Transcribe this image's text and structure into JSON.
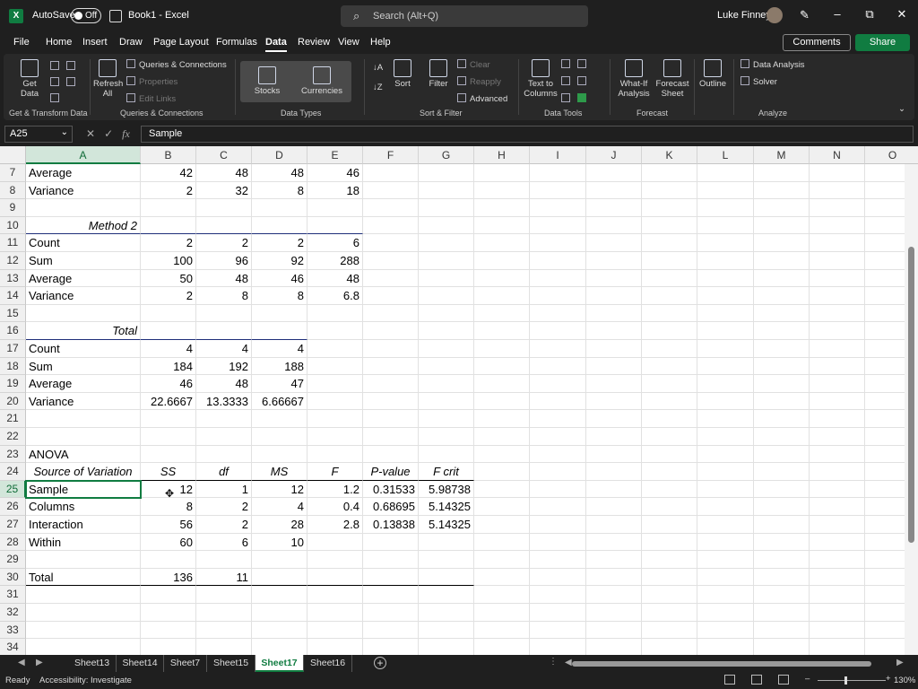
{
  "title_bar": {
    "logo": "X",
    "autosave_label": "AutoSave",
    "autosave_state": "Off",
    "document_title": "Book1  -  Excel",
    "search_placeholder": "Search (Alt+Q)",
    "user_name": "Luke Finney",
    "icons": [
      "excel-logo-icon",
      "save-icon",
      "search-icon",
      "pen-icon",
      "minimize-icon",
      "restore-icon",
      "close-icon"
    ],
    "window_buttons": [
      "–",
      "⧉",
      "✕"
    ]
  },
  "menu": {
    "tabs": [
      "File",
      "Home",
      "Insert",
      "Draw",
      "Page Layout",
      "Formulas",
      "Data",
      "Review",
      "View",
      "Help"
    ],
    "active_tab": "Data",
    "comments_label": "Comments",
    "share_label": "Share"
  },
  "ribbon": {
    "get_data": "Get Data",
    "refresh_all": "Refresh All",
    "queries_connections": "Queries & Connections",
    "properties": "Properties",
    "edit_links": "Edit Links",
    "stocks": "Stocks",
    "currencies": "Currencies",
    "sort": "Sort",
    "filter": "Filter",
    "clear": "Clear",
    "reapply": "Reapply",
    "advanced": "Advanced",
    "text_to_columns": "Text to Columns",
    "what_if": "What-If Analysis",
    "forecast_sheet": "Forecast Sheet",
    "outline": "Outline",
    "data_analysis": "Data Analysis",
    "solver": "Solver",
    "groups": {
      "get_transform": "Get & Transform Data",
      "queries": "Queries & Connections",
      "data_types": "Data Types",
      "sort_filter": "Sort & Filter",
      "data_tools": "Data Tools",
      "forecast": "Forecast",
      "analyze": "Analyze"
    }
  },
  "formula_bar": {
    "name_box": "A25",
    "fx": "fx",
    "content": "Sample"
  },
  "columns": [
    "A",
    "B",
    "C",
    "D",
    "E",
    "F",
    "G",
    "H",
    "I",
    "J",
    "K",
    "L",
    "M",
    "N",
    "O"
  ],
  "selected_column": "A",
  "rows": [
    {
      "n": "7",
      "A": "Average",
      "B": "42",
      "C": "48",
      "D": "48",
      "E": "46"
    },
    {
      "n": "8",
      "A": "Variance",
      "B": "2",
      "C": "32",
      "D": "8",
      "E": "18"
    },
    {
      "n": "9"
    },
    {
      "n": "10",
      "A": "Method 2",
      "a_style": "header"
    },
    {
      "n": "11",
      "A": "Count",
      "B": "2",
      "C": "2",
      "D": "2",
      "E": "6"
    },
    {
      "n": "12",
      "A": "Sum",
      "B": "100",
      "C": "96",
      "D": "92",
      "E": "288"
    },
    {
      "n": "13",
      "A": "Average",
      "B": "50",
      "C": "48",
      "D": "46",
      "E": "48"
    },
    {
      "n": "14",
      "A": "Variance",
      "B": "2",
      "C": "8",
      "D": "8",
      "E": "6.8"
    },
    {
      "n": "15"
    },
    {
      "n": "16",
      "A": "Total",
      "a_style": "header_short"
    },
    {
      "n": "17",
      "A": "Count",
      "B": "4",
      "C": "4",
      "D": "4"
    },
    {
      "n": "18",
      "A": "Sum",
      "B": "184",
      "C": "192",
      "D": "188"
    },
    {
      "n": "19",
      "A": "Average",
      "B": "46",
      "C": "48",
      "D": "47"
    },
    {
      "n": "20",
      "A": "Variance",
      "B": "22.6667",
      "C": "13.3333",
      "D": "6.66667"
    },
    {
      "n": "21"
    },
    {
      "n": "22"
    },
    {
      "n": "23",
      "A": "ANOVA"
    },
    {
      "n": "24",
      "A": "Source of Variation",
      "B": "SS",
      "C": "df",
      "D": "MS",
      "E": "F",
      "F": "P-value",
      "G": "F crit",
      "a_style": "anova_header"
    },
    {
      "n": "25",
      "A": "Sample",
      "B": "12",
      "C": "1",
      "D": "12",
      "E": "1.2",
      "F": "0.31533",
      "G": "5.98738",
      "active": true
    },
    {
      "n": "26",
      "A": "Columns",
      "B": "8",
      "C": "2",
      "D": "4",
      "E": "0.4",
      "F": "0.68695",
      "G": "5.14325"
    },
    {
      "n": "27",
      "A": "Interaction",
      "B": "56",
      "C": "2",
      "D": "28",
      "E": "2.8",
      "F": "0.13838",
      "G": "5.14325"
    },
    {
      "n": "28",
      "A": "Within",
      "B": "60",
      "C": "6",
      "D": "10"
    },
    {
      "n": "29"
    },
    {
      "n": "30",
      "A": "Total",
      "B": "136",
      "C": "11",
      "a_style": "total_final"
    },
    {
      "n": "31"
    },
    {
      "n": "32"
    },
    {
      "n": "33"
    },
    {
      "n": "34"
    }
  ],
  "sheet_tabs": [
    "Sheet13",
    "Sheet14",
    "Sheet7",
    "Sheet15",
    "Sheet17",
    "Sheet16"
  ],
  "active_sheet": "Sheet17",
  "status": {
    "ready": "Ready",
    "accessibility": "Accessibility: Investigate",
    "zoom": "130%"
  }
}
